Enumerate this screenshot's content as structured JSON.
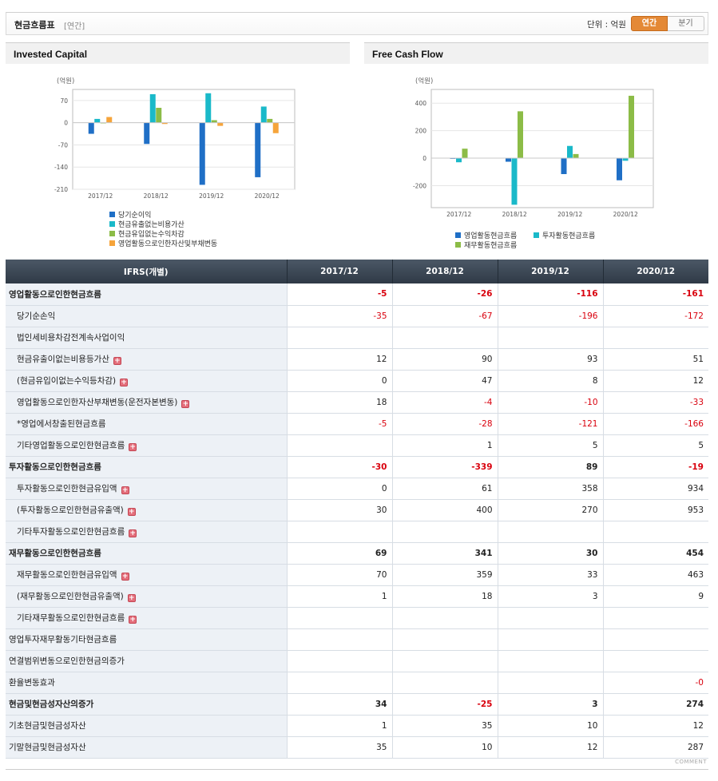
{
  "header": {
    "title": "현금흐름표",
    "subtitle": "[연간]",
    "unit_label": "단위 : 억원",
    "tabs": [
      {
        "label": "연간",
        "active": true
      },
      {
        "label": "분기",
        "active": false
      }
    ]
  },
  "chart_data": [
    {
      "type": "bar",
      "title": "Invested Capital",
      "ylabel": "(억원)",
      "categories": [
        "2017/12",
        "2018/12",
        "2019/12",
        "2020/12"
      ],
      "ylim": [
        -210,
        105
      ],
      "yticks": [
        70,
        0,
        -70,
        -140,
        -210
      ],
      "series": [
        {
          "name": "당기순이익",
          "color": "#1f6fc6",
          "values": [
            -35,
            -67,
            -196,
            -172
          ]
        },
        {
          "name": "현금유출없는비용가산",
          "color": "#1ab9c9",
          "values": [
            12,
            90,
            93,
            51
          ]
        },
        {
          "name": "현금유입없는수익차감",
          "color": "#8cbc47",
          "values": [
            0,
            47,
            8,
            12
          ]
        },
        {
          "name": "영업활동으로인한자산및부채변동",
          "color": "#f6a43a",
          "values": [
            18,
            -4,
            -10,
            -33
          ]
        }
      ]
    },
    {
      "type": "bar",
      "title": "Free Cash Flow",
      "ylabel": "(억원)",
      "categories": [
        "2017/12",
        "2018/12",
        "2019/12",
        "2020/12"
      ],
      "ylim": [
        -360,
        500
      ],
      "yticks": [
        400,
        200,
        0,
        -200
      ],
      "series": [
        {
          "name": "영업활동현금흐름",
          "color": "#1f6fc6",
          "values": [
            -5,
            -26,
            -116,
            -161
          ]
        },
        {
          "name": "투자활동현금흐름",
          "color": "#1ab9c9",
          "values": [
            -30,
            -339,
            89,
            -19
          ]
        },
        {
          "name": "재무활동현금흐름",
          "color": "#8cbc47",
          "values": [
            69,
            341,
            30,
            454
          ]
        }
      ]
    }
  ],
  "table": {
    "corner": "IFRS(개별)",
    "columns": [
      "2017/12",
      "2018/12",
      "2019/12",
      "2020/12"
    ],
    "rows": [
      {
        "label": "영업활동으로인한현금흐름",
        "main": true,
        "plus": false,
        "values": [
          "-5",
          "-26",
          "-116",
          "-161"
        ]
      },
      {
        "label": "당기순손익",
        "main": false,
        "plus": false,
        "values": [
          "-35",
          "-67",
          "-196",
          "-172"
        ]
      },
      {
        "label": "법인세비용차감전계속사업이익",
        "main": false,
        "plus": false,
        "values": [
          "",
          "",
          "",
          ""
        ]
      },
      {
        "label": "현금유출이없는비용등가산",
        "main": false,
        "plus": true,
        "values": [
          "12",
          "90",
          "93",
          "51"
        ]
      },
      {
        "label": "(현금유입이없는수익등차감)",
        "main": false,
        "plus": true,
        "values": [
          "0",
          "47",
          "8",
          "12"
        ]
      },
      {
        "label": "영업활동으로인한자산부채변동(운전자본변동)",
        "main": false,
        "plus": true,
        "values": [
          "18",
          "-4",
          "-10",
          "-33"
        ]
      },
      {
        "label": "*영업에서창출된현금흐름",
        "main": false,
        "plus": false,
        "values": [
          "-5",
          "-28",
          "-121",
          "-166"
        ]
      },
      {
        "label": "기타영업활동으로인한현금흐름",
        "main": false,
        "plus": true,
        "values": [
          "",
          "1",
          "5",
          "5"
        ]
      },
      {
        "label": "투자활동으로인한현금흐름",
        "main": true,
        "plus": false,
        "values": [
          "-30",
          "-339",
          "89",
          "-19"
        ]
      },
      {
        "label": "투자활동으로인한현금유입액",
        "main": false,
        "plus": true,
        "values": [
          "0",
          "61",
          "358",
          "934"
        ]
      },
      {
        "label": "(투자활동으로인한현금유출액)",
        "main": false,
        "plus": true,
        "values": [
          "30",
          "400",
          "270",
          "953"
        ]
      },
      {
        "label": "기타투자활동으로인한현금흐름",
        "main": false,
        "plus": true,
        "values": [
          "",
          "",
          "",
          ""
        ]
      },
      {
        "label": "재무활동으로인한현금흐름",
        "main": true,
        "plus": false,
        "values": [
          "69",
          "341",
          "30",
          "454"
        ]
      },
      {
        "label": "재무활동으로인한현금유입액",
        "main": false,
        "plus": true,
        "values": [
          "70",
          "359",
          "33",
          "463"
        ]
      },
      {
        "label": "(재무활동으로인한현금유출액)",
        "main": false,
        "plus": true,
        "values": [
          "1",
          "18",
          "3",
          "9"
        ]
      },
      {
        "label": "기타재무활동으로인한현금흐름",
        "main": false,
        "plus": true,
        "values": [
          "",
          "",
          "",
          ""
        ]
      },
      {
        "label": "영업투자재무활동기타현금흐름",
        "main": false,
        "top": true,
        "plus": false,
        "values": [
          "",
          "",
          "",
          ""
        ]
      },
      {
        "label": "연결범위변동으로인한현금의증가",
        "main": false,
        "top": true,
        "plus": false,
        "values": [
          "",
          "",
          "",
          ""
        ]
      },
      {
        "label": "환율변동효과",
        "main": false,
        "top": true,
        "plus": false,
        "values": [
          "",
          "",
          "",
          "-0"
        ]
      },
      {
        "label": "현금및현금성자산의증가",
        "main": true,
        "plus": false,
        "values": [
          "34",
          "-25",
          "3",
          "274"
        ]
      },
      {
        "label": "기초현금및현금성자산",
        "main": false,
        "top": true,
        "plus": false,
        "values": [
          "1",
          "35",
          "10",
          "12"
        ]
      },
      {
        "label": "기말현금및현금성자산",
        "main": false,
        "top": true,
        "plus": false,
        "values": [
          "35",
          "10",
          "12",
          "287"
        ]
      }
    ]
  },
  "footer": {
    "comment_label": "COMMENT"
  }
}
